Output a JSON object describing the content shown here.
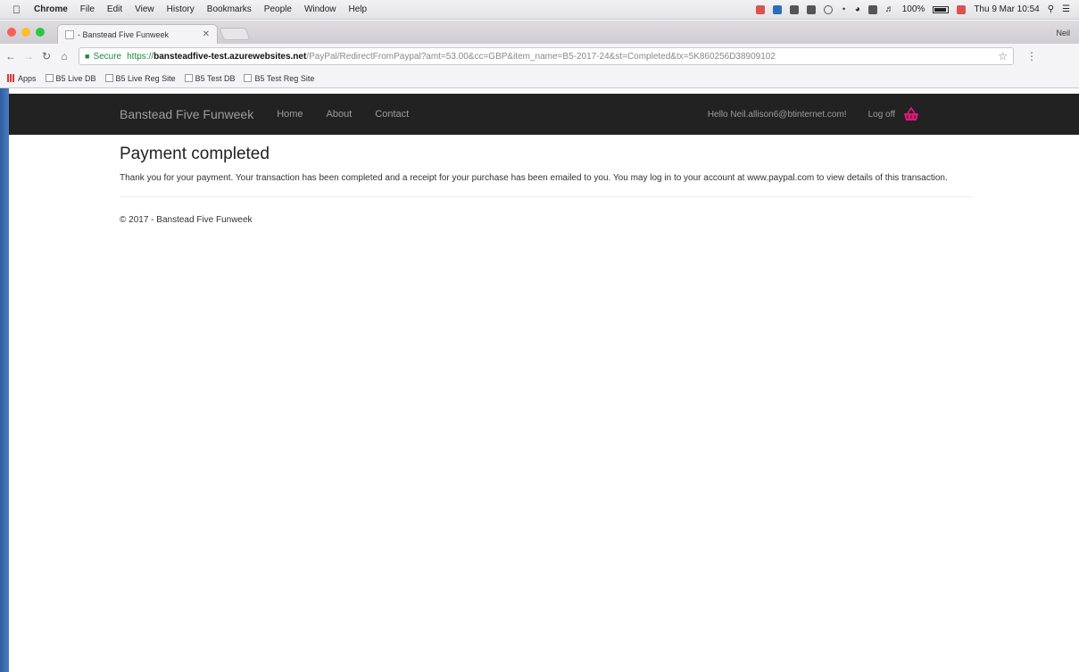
{
  "menubar": {
    "app": "Chrome",
    "items": [
      "File",
      "Edit",
      "View",
      "History",
      "Bookmarks",
      "People",
      "Window",
      "Help"
    ],
    "battery": "100%",
    "clock": "Thu 9 Mar  10:54"
  },
  "browser": {
    "tab_title": "- Banstead Five Funweek",
    "profile": "Neil",
    "secure_label": "Secure",
    "url_scheme": "https://",
    "url_host": "bansteadfive-test.azurewebsites.net",
    "url_path": "/PayPal/RedirectFromPaypal?amt=53.00&cc=GBP&item_name=B5-2017-24&st=Completed&tx=5K860256D38909102"
  },
  "bookmarks": [
    "Apps",
    "B5 Live DB",
    "B5 Live Reg Site",
    "B5 Test DB",
    "B5 Test Reg Site"
  ],
  "site": {
    "brand": "Banstead Five Funweek",
    "nav": [
      "Home",
      "About",
      "Contact"
    ],
    "hello": "Hello Neil.allison6@btinternet.com!",
    "logoff": "Log off",
    "basket_color": "#e0197d"
  },
  "page": {
    "title": "Payment completed",
    "message": "Thank you for your payment. Your transaction has been completed and a receipt for your purchase has been emailed to you. You may log in to your account at www.paypal.com to view details of this transaction.",
    "footer": "© 2017 - Banstead Five Funweek"
  }
}
